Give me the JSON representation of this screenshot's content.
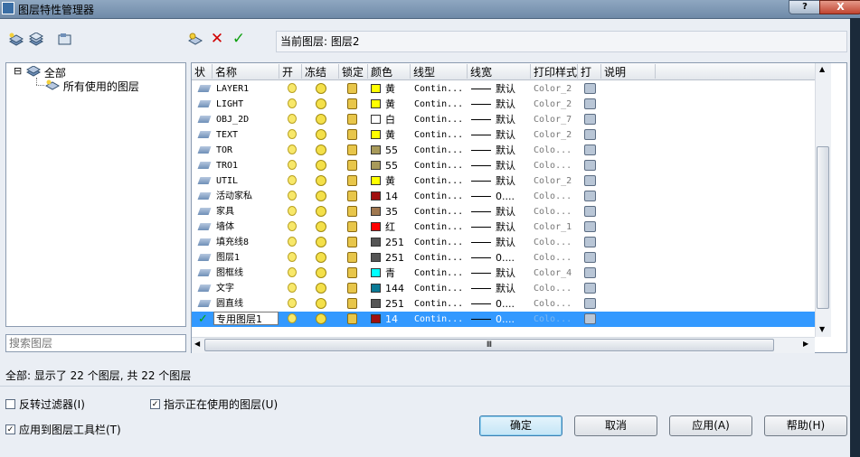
{
  "window": {
    "title": "图层特性管理器",
    "help_label": "?",
    "close_label": "X"
  },
  "toolbar": {
    "current_layer_label": "当前图层:",
    "current_layer_value": "图层2"
  },
  "tree": {
    "root": "全部",
    "child": "所有使用的图层",
    "expander": "⊟"
  },
  "search": {
    "placeholder": "搜索图层"
  },
  "columns": [
    "状",
    "名称",
    "开",
    "冻结",
    "锁定",
    "颜色",
    "线型",
    "线宽",
    "打印样式",
    "打",
    "说明"
  ],
  "layers": [
    {
      "name": "LAYER1",
      "color_name": "黄",
      "color": "#ffff00",
      "linetype": "Contin...",
      "lineweight": "默认",
      "plotstyle": "Color_2"
    },
    {
      "name": "LIGHT",
      "color_name": "黄",
      "color": "#ffff00",
      "linetype": "Contin...",
      "lineweight": "默认",
      "plotstyle": "Color_2"
    },
    {
      "name": "OBJ_2D",
      "color_name": "白",
      "color": "#ffffff",
      "linetype": "Contin...",
      "lineweight": "默认",
      "plotstyle": "Color_7"
    },
    {
      "name": "TEXT",
      "color_name": "黄",
      "color": "#ffff00",
      "linetype": "Contin...",
      "lineweight": "默认",
      "plotstyle": "Color_2"
    },
    {
      "name": "TOR",
      "color_name": "55",
      "color": "#a89a5a",
      "linetype": "Contin...",
      "lineweight": "默认",
      "plotstyle": "Colo..."
    },
    {
      "name": "TRO1",
      "color_name": "55",
      "color": "#a89a5a",
      "linetype": "Contin...",
      "lineweight": "默认",
      "plotstyle": "Colo..."
    },
    {
      "name": "UTIL",
      "color_name": "黄",
      "color": "#ffff00",
      "linetype": "Contin...",
      "lineweight": "默认",
      "plotstyle": "Color_2"
    },
    {
      "name": "活动家私",
      "color_name": "14",
      "color": "#a01010",
      "linetype": "Contin...",
      "lineweight": "0....",
      "plotstyle": "Colo..."
    },
    {
      "name": "家具",
      "color_name": "35",
      "color": "#a07850",
      "linetype": "Contin...",
      "lineweight": "默认",
      "plotstyle": "Colo..."
    },
    {
      "name": "墙体",
      "color_name": "红",
      "color": "#ff0000",
      "linetype": "Contin...",
      "lineweight": "默认",
      "plotstyle": "Color_1"
    },
    {
      "name": "填充线8",
      "color_name": "251",
      "color": "#555555",
      "linetype": "Contin...",
      "lineweight": "默认",
      "plotstyle": "Colo..."
    },
    {
      "name": "图层1",
      "color_name": "251",
      "color": "#555555",
      "linetype": "Contin...",
      "lineweight": "0....",
      "plotstyle": "Colo..."
    },
    {
      "name": "图框线",
      "color_name": "青",
      "color": "#00ffff",
      "linetype": "Contin...",
      "lineweight": "默认",
      "plotstyle": "Color_4"
    },
    {
      "name": "文字",
      "color_name": "144",
      "color": "#0a7a96",
      "linetype": "Contin...",
      "lineweight": "默认",
      "plotstyle": "Colo..."
    },
    {
      "name": "圆直线",
      "color_name": "251",
      "color": "#555555",
      "linetype": "Contin...",
      "lineweight": "0....",
      "plotstyle": "Colo..."
    },
    {
      "name": "专用图层1",
      "color_name": "14",
      "color": "#a01010",
      "linetype": "Contin...",
      "lineweight": "0....",
      "plotstyle": "Colo...",
      "current": true,
      "status": "✓"
    }
  ],
  "status_text": "全部: 显示了 22 个图层, 共 22 个图层",
  "options": {
    "invert_filter": "反转过滤器(I)",
    "indicate_in_use": "指示正在使用的图层(U)",
    "indicate_checked_mark": "✓",
    "apply_toolbar": "应用到图层工具栏(T)",
    "apply_checked_mark": "✓"
  },
  "buttons": {
    "ok": "确定",
    "cancel": "取消",
    "apply": "应用(A)",
    "help": "帮助(H)"
  },
  "scroll_mark": "Ⅲ"
}
